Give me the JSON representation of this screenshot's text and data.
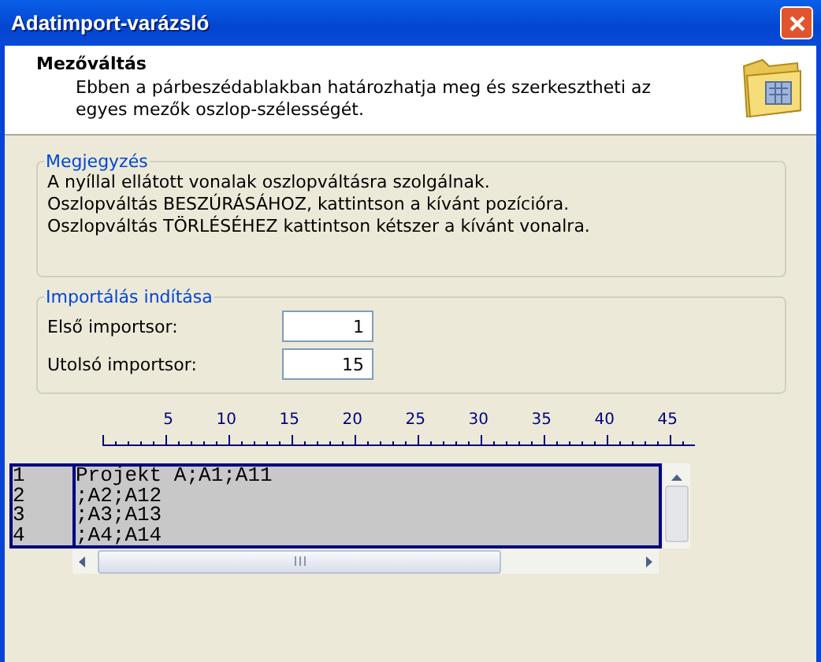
{
  "window": {
    "title": "Adatimport-varázsló"
  },
  "header": {
    "title": "Mezőváltás",
    "description": "Ebben a párbeszédablakban határozhatja meg és szerkesztheti az egyes mezők oszlop-szélességét."
  },
  "note_group": {
    "title": "Megjegyzés",
    "lines": [
      "A nyíllal ellátott vonalak oszlopváltásra szolgálnak.",
      "Oszlopváltás BESZÚRÁSÁHOZ, kattintson a kívánt pozícióra.",
      "Oszlopváltás TÖRLÉSÉHEZ kattintson kétszer a kívánt vonalra."
    ]
  },
  "import_group": {
    "title": "Importálás indítása",
    "fields": [
      {
        "label": "Első importsor:",
        "value": "1"
      },
      {
        "label": "Utolsó importsor:",
        "value": "15"
      }
    ]
  },
  "ruler": [
    "5",
    "10",
    "15",
    "20",
    "25",
    "30",
    "35",
    "40",
    "45"
  ],
  "preview_rows": [
    {
      "number": "1",
      "text": "Projekt A;A1;A11"
    },
    {
      "number": "2",
      "text": ";A2;A12"
    },
    {
      "number": "3",
      "text": ";A3;A13"
    },
    {
      "number": "4",
      "text": ";A4;A14"
    }
  ]
}
